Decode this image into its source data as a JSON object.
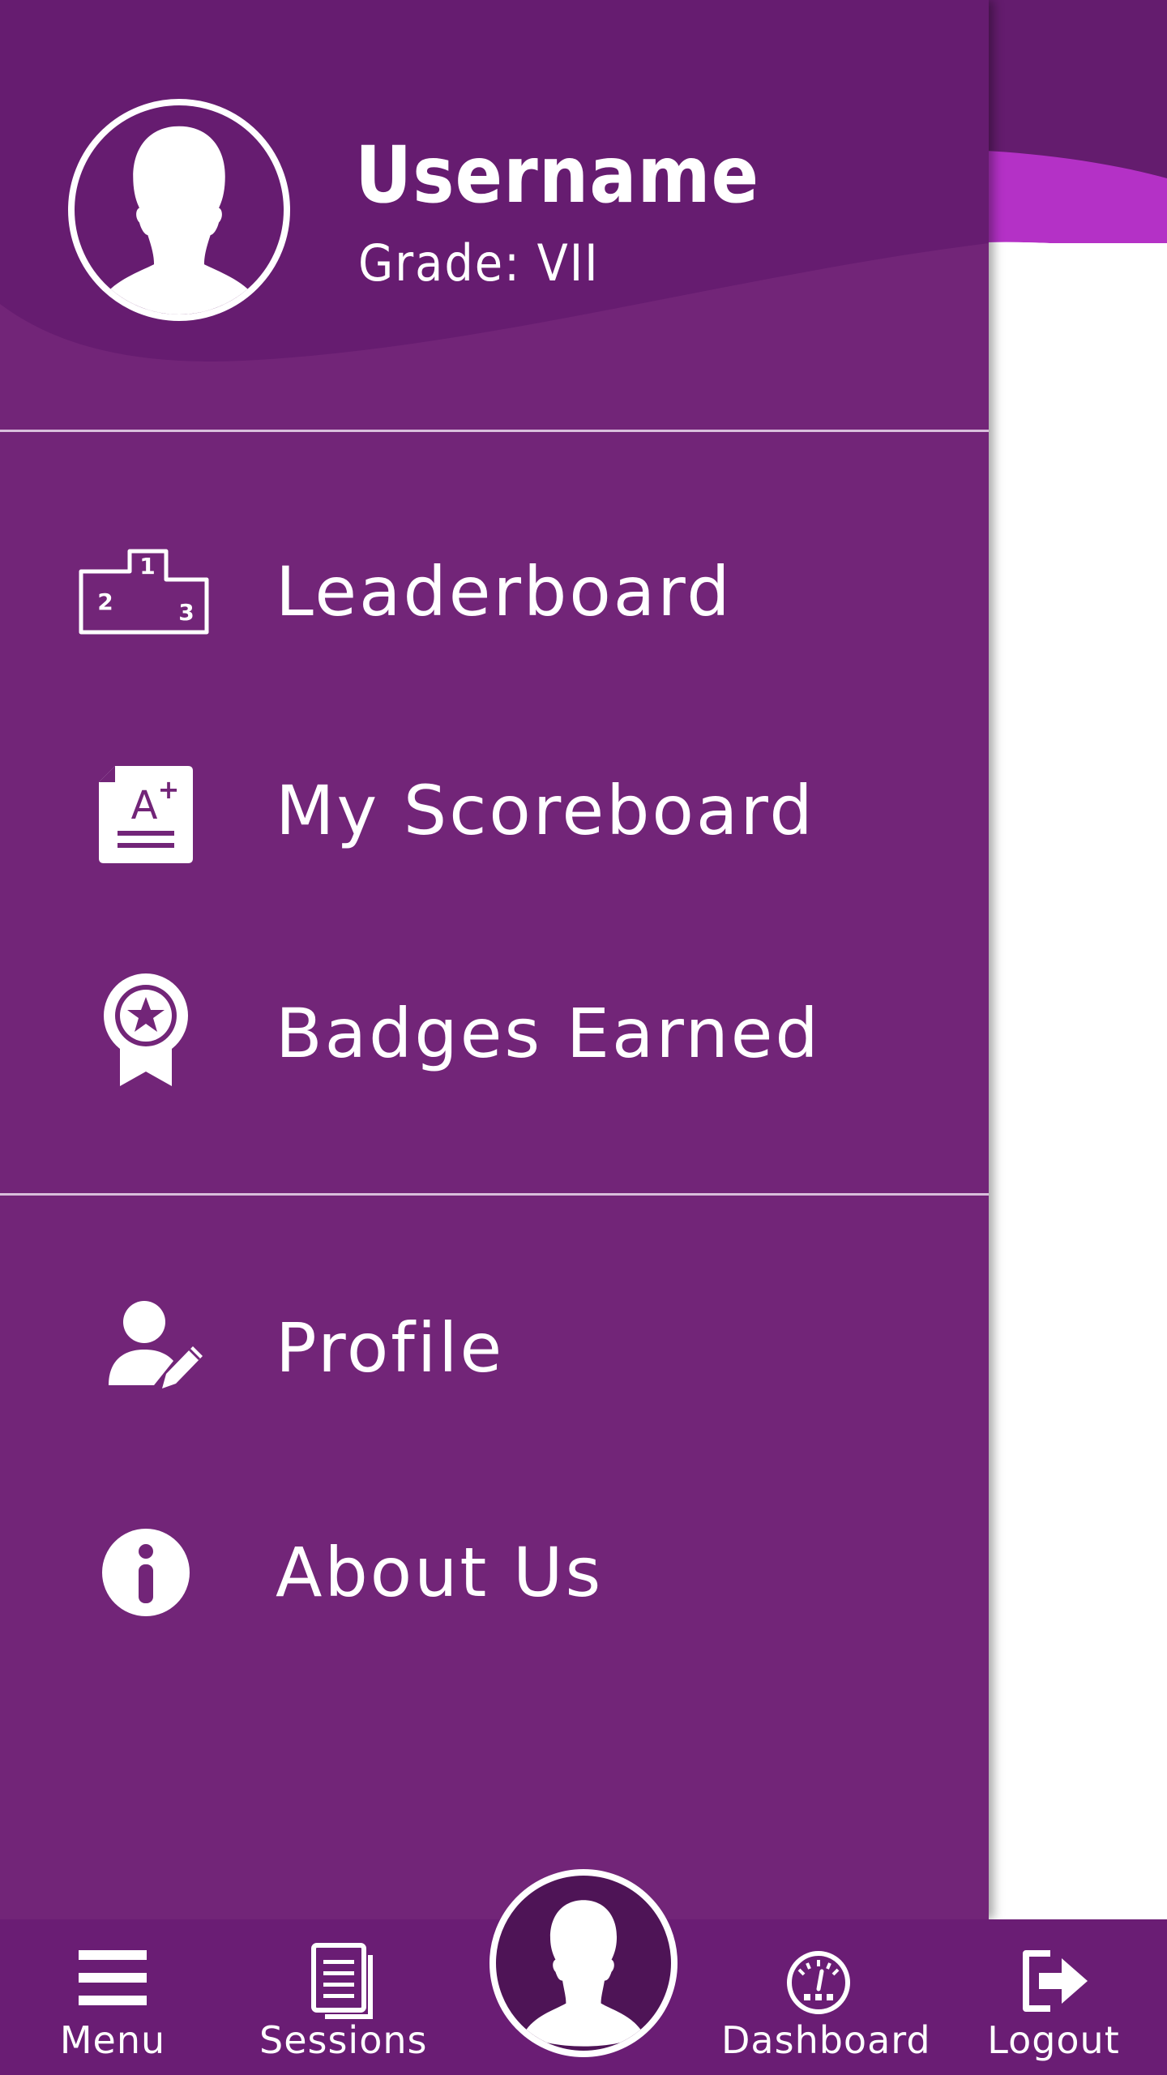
{
  "header": {
    "username": "Username",
    "grade": "Grade: VII"
  },
  "menu": {
    "items": [
      {
        "label": "Leaderboard",
        "icon": "podium-icon"
      },
      {
        "label": "My Scoreboard",
        "icon": "grade-report-icon"
      },
      {
        "label": "Badges Earned",
        "icon": "badge-ribbon-icon"
      },
      {
        "label": "Profile",
        "icon": "edit-user-icon"
      },
      {
        "label": "About Us",
        "icon": "info-icon"
      }
    ]
  },
  "bottom_nav": {
    "items": [
      {
        "label": "Menu",
        "icon": "hamburger-icon"
      },
      {
        "label": "Sessions",
        "icon": "documents-icon"
      },
      {
        "label": "",
        "icon": "user-avatar-icon"
      },
      {
        "label": "Dashboard",
        "icon": "speedometer-icon"
      },
      {
        "label": "Logout",
        "icon": "logout-icon"
      }
    ]
  },
  "colors": {
    "drawer": "#722578",
    "header_dark": "#661c70",
    "accent_magenta": "#b431c6",
    "bottom_bar": "#6a1d74",
    "text": "#ffffff"
  }
}
